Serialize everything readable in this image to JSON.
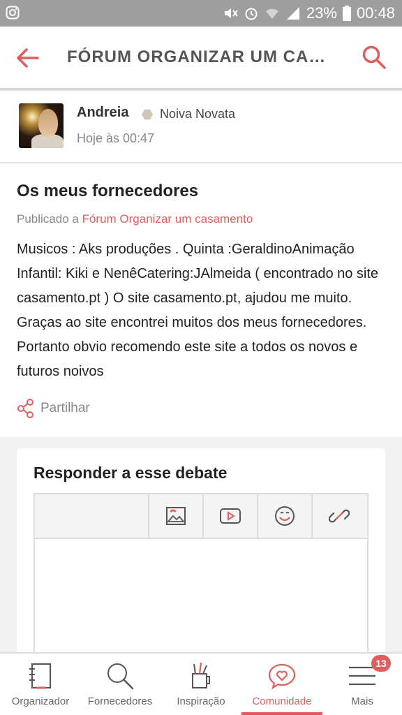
{
  "status_bar": {
    "battery_percent": "23%",
    "time": "00:48",
    "icons": [
      "instagram-icon",
      "mute-icon",
      "alarm-icon",
      "wifi-icon",
      "signal-icon",
      "battery-icon"
    ]
  },
  "app_bar": {
    "title": "FÓRUM ORGANIZAR UM CA…",
    "back_icon": "arrow-left-icon",
    "search_icon": "search-icon"
  },
  "post": {
    "author": {
      "name": "Andreia",
      "rank": "Noiva Novata",
      "time": "Hoje às 00:47"
    },
    "title": "Os meus fornecedores",
    "published_prefix": "Publicado a",
    "forum_link": "Fórum Organizar um casamento",
    "body": "Musicos : Aks produções . Quinta :GeraldinoAnimação Infantil: Kiki e NenêCatering:JAlmeida ( encontrado no site casamento.pt ) O site casamento.pt, ajudou me muito. Graças ao site encontrei muitos dos meus fornecedores. Portanto obvio recomendo este site a todos os novos e futuros noivos",
    "share_label": "Partilhar"
  },
  "reply": {
    "title": "Responder a esse debate",
    "toolbar_icons": [
      "image-icon",
      "video-icon",
      "emoji-icon",
      "link-icon"
    ]
  },
  "bottom_nav": {
    "items": [
      {
        "label": "Organizador",
        "icon": "notebook-icon"
      },
      {
        "label": "Fornecedores",
        "icon": "search-icon"
      },
      {
        "label": "Inspiração",
        "icon": "pencil-cup-icon"
      },
      {
        "label": "Comunidade",
        "icon": "heart-chat-icon",
        "active": true
      },
      {
        "label": "Mais",
        "icon": "menu-icon"
      }
    ],
    "badge": "13"
  },
  "colors": {
    "accent": "#e05d5d",
    "status_bar": "#9e9e9e",
    "muted_text": "#888888"
  }
}
